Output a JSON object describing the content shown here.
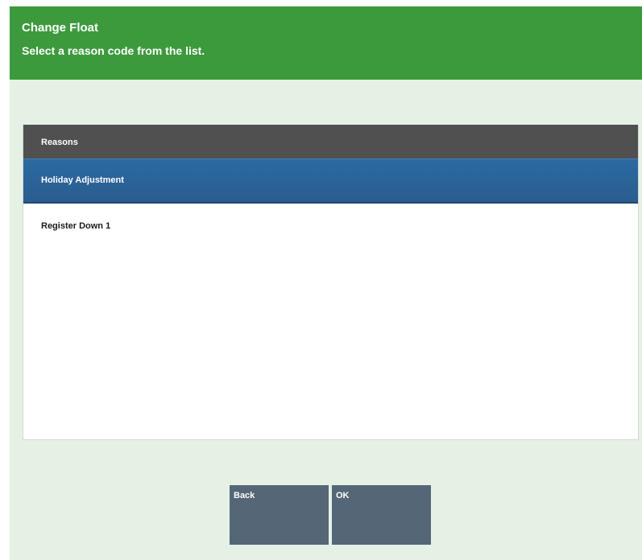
{
  "header": {
    "title": "Change Float",
    "subtitle": "Select a reason code from the list."
  },
  "list": {
    "header": "Reasons",
    "items": [
      {
        "label": "Holiday Adjustment",
        "selected": true
      },
      {
        "label": "Register Down 1",
        "selected": false
      }
    ]
  },
  "buttons": {
    "back_label": "Back",
    "ok_label": "OK"
  },
  "colors": {
    "header_bg": "#3c9a3c",
    "page_bg": "#e6f1e6",
    "list_header_bg": "#505050",
    "selected_bg": "#2b6aa2",
    "button_bg": "#556677"
  }
}
